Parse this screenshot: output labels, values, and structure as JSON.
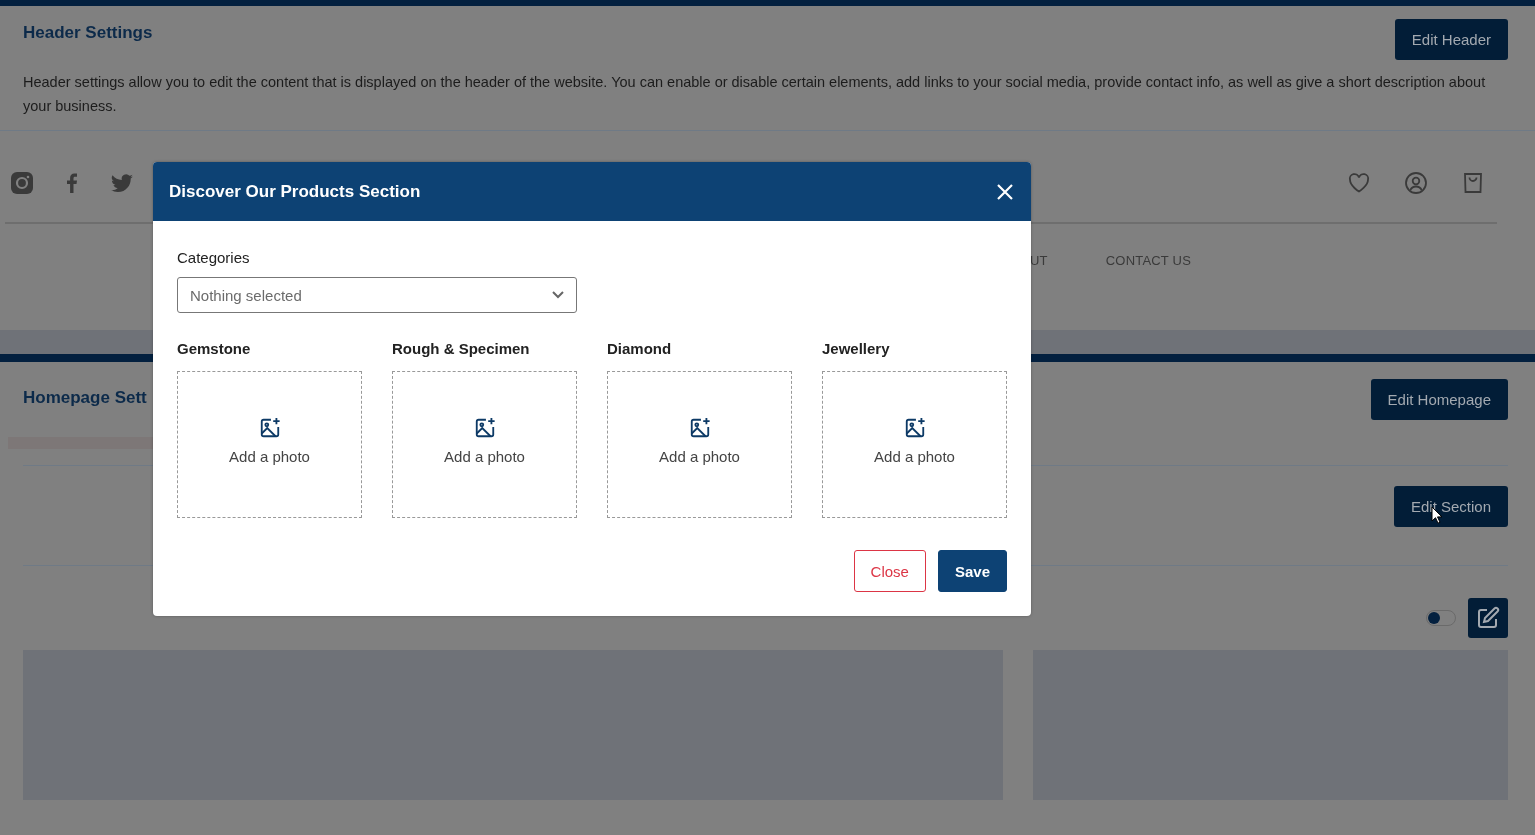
{
  "header_settings": {
    "title": "Header Settings",
    "description": "Header settings allow you to edit the content that is displayed on the header of the website. You can enable or disable certain elements, add links to your social media, provide contact info, as well as give a short description about your business.",
    "edit_button": "Edit Header"
  },
  "nav_preview": {
    "links": [
      "UT",
      "CONTACT US"
    ]
  },
  "homepage_settings": {
    "title": "Homepage Sett",
    "edit_button": "Edit Homepage",
    "section_button": "Edit Section",
    "toggle": {
      "on": false
    }
  },
  "modal": {
    "title": "Discover Our Products Section",
    "categories_label": "Categories",
    "select": {
      "placeholder": "Nothing selected"
    },
    "tiles": [
      {
        "label": "Gemstone",
        "action": "Add a photo"
      },
      {
        "label": "Rough & Specimen",
        "action": "Add a photo"
      },
      {
        "label": "Diamond",
        "action": "Add a photo"
      },
      {
        "label": "Jewellery",
        "action": "Add a photo"
      }
    ],
    "buttons": [
      {
        "label": "Close",
        "kind": "outline"
      },
      {
        "label": "Save",
        "kind": "primary"
      }
    ]
  }
}
